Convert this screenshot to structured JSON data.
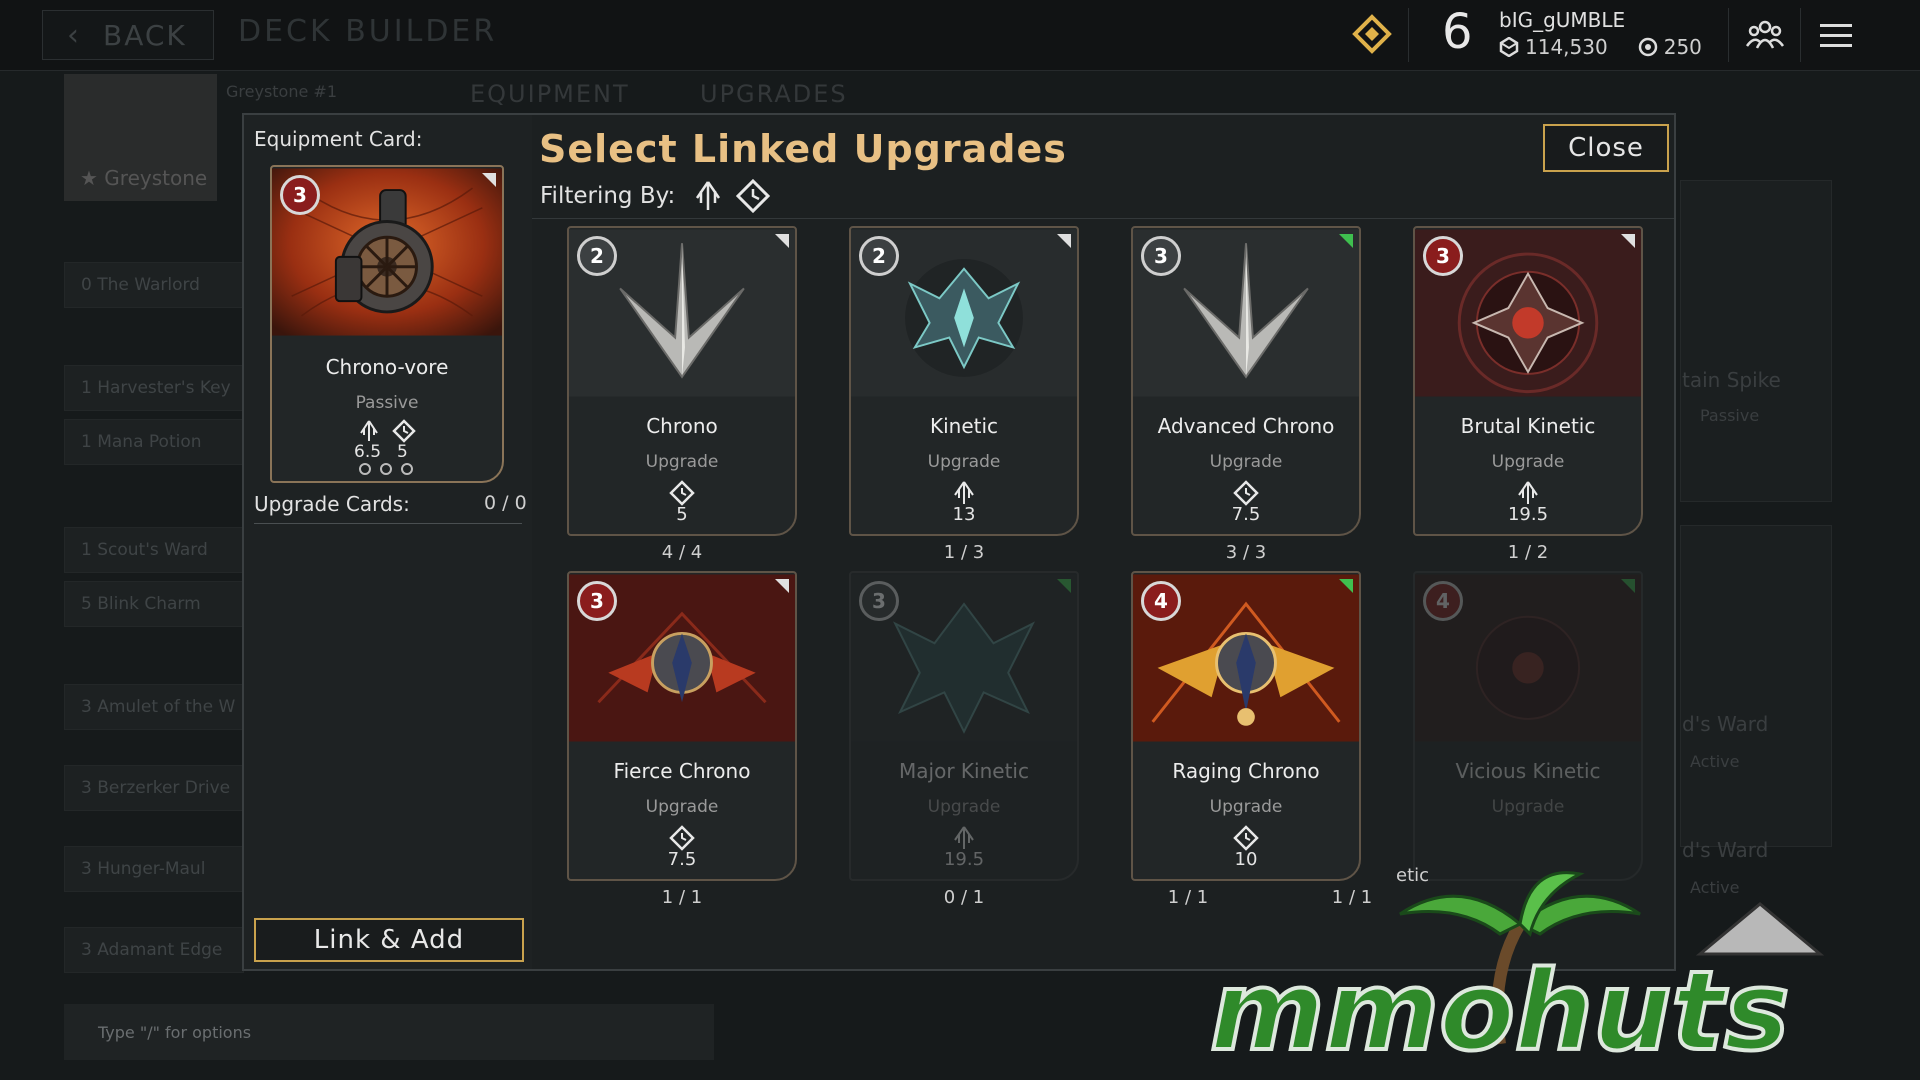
{
  "topbar": {
    "back_label": "BACK",
    "page_title": "DECK BUILDER",
    "level": "6",
    "username": "bIG_gUMBLE",
    "currency_1": "114,530",
    "currency_2": "250"
  },
  "background": {
    "hero_name": "Greystone",
    "hero_sub": "Greystone #1",
    "tab_equipment": "EQUIPMENT",
    "tab_upgrades": "UPGRADES",
    "list_items": [
      "0 The Warlord",
      "1 Harvester's Key",
      "1 Mana Potion",
      "1 Scout's Ward",
      "5 Blink Charm",
      "3 Amulet of the W",
      "3 Berzerker Drive",
      "3 Hunger-Maul",
      "3 Adamant Edge"
    ],
    "right_texts": [
      "tain Spike",
      "Passive",
      "d's Ward",
      "Active",
      "d's Ward",
      "Active"
    ],
    "chat_placeholder": "Type \"/\" for options"
  },
  "modal": {
    "title": "Select Linked Upgrades",
    "filter_label": "Filtering By:",
    "close_label": "Close",
    "equipment_label": "Equipment Card:",
    "upgrade_cards_label": "Upgrade Cards:",
    "upgrade_cards_count": "0 / 0",
    "link_add_label": "Link & Add",
    "stray_text": "etic",
    "equipment_card": {
      "cost": "3",
      "name": "Chrono-vore",
      "type": "Passive",
      "stat_1": "6.5",
      "stat_2": "5"
    },
    "cards": [
      {
        "cost": "2",
        "name": "Chrono",
        "type": "Upgrade",
        "stat": "5",
        "count": "4 / 4"
      },
      {
        "cost": "2",
        "name": "Kinetic",
        "type": "Upgrade",
        "stat": "13",
        "count": "1 / 3"
      },
      {
        "cost": "3",
        "name": "Advanced Chrono",
        "type": "Upgrade",
        "stat": "7.5",
        "count": "3 / 3"
      },
      {
        "cost": "3",
        "name": "Brutal Kinetic",
        "type": "Upgrade",
        "stat": "19.5",
        "count": "1 / 2"
      },
      {
        "cost": "3",
        "name": "Fierce Chrono",
        "type": "Upgrade",
        "stat": "7.5",
        "count": "1 / 1"
      },
      {
        "cost": "3",
        "name": "Major Kinetic",
        "type": "Upgrade",
        "stat": "19.5",
        "count": "0 / 1"
      },
      {
        "cost": "4",
        "name": "Raging Chrono",
        "type": "Upgrade",
        "stat": "10",
        "count": "1 / 1"
      },
      {
        "cost": "4",
        "name": "Vicious Kinetic",
        "type": "Upgrade",
        "stat": "",
        "count": "1 / 1"
      }
    ]
  },
  "colors": {
    "accent_gold": "#c9a24d",
    "title_gold": "#e8c084",
    "cost_red": "#8a1d1d",
    "logo_green": "#2f8a2a"
  },
  "watermark": "mmohuts"
}
